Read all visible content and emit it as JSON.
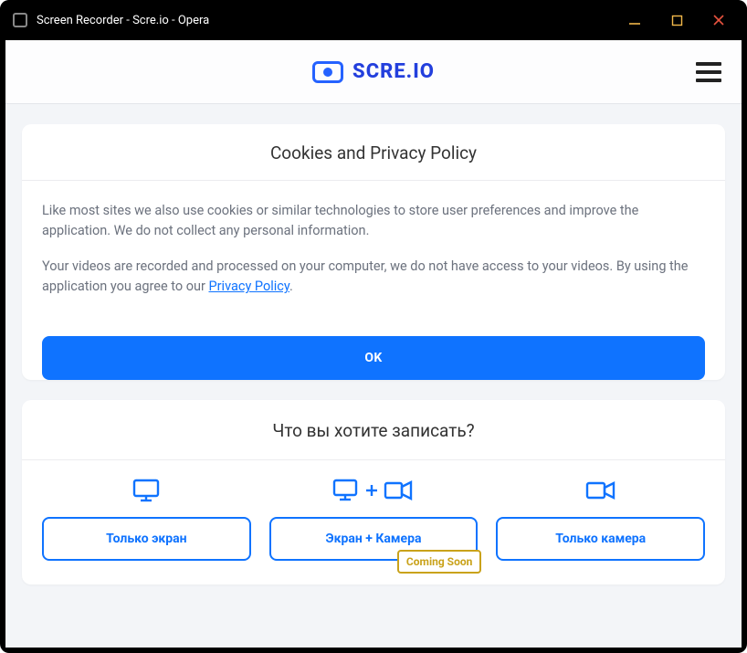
{
  "window": {
    "title": "Screen Recorder - Scre.io - Opera"
  },
  "header": {
    "brand": "SCRE.IO"
  },
  "privacy": {
    "title": "Cookies and Privacy Policy",
    "p1": "Like most sites we also use cookies or similar technologies to store user preferences and improve the application. We do not collect any personal information.",
    "p2a": "Your videos are recorded and processed on your computer, we do not have access to your videos. By using the application you agree to our ",
    "link": "Privacy Policy",
    "p2b": ".",
    "ok": "OK"
  },
  "record": {
    "title": "Что вы хотите записать?",
    "options": {
      "screen": "Только экран",
      "screen_camera": "Экран + Камера",
      "camera": "Только камера"
    },
    "badge": "Coming Soon"
  }
}
